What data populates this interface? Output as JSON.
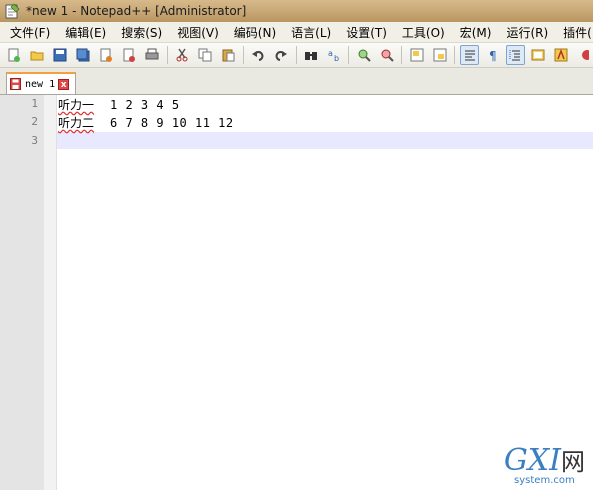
{
  "window": {
    "title": "*new 1 - Notepad++ [Administrator]"
  },
  "menubar": {
    "items": [
      "文件(F)",
      "编辑(E)",
      "搜索(S)",
      "视图(V)",
      "编码(N)",
      "语言(L)",
      "设置(T)",
      "工具(O)",
      "宏(M)",
      "运行(R)",
      "插件(P)"
    ]
  },
  "toolbar": {
    "icons": [
      "new-file-icon",
      "open-file-icon",
      "save-icon",
      "save-all-icon",
      "close-icon",
      "close-all-icon",
      "print-icon",
      "cut-icon",
      "copy-icon",
      "paste-icon",
      "undo-icon",
      "redo-icon",
      "find-icon",
      "replace-icon",
      "zoom-in-icon",
      "zoom-out-icon",
      "sync-vertical-icon",
      "sync-horizontal-icon",
      "word-wrap-icon",
      "show-all-chars-icon",
      "indent-guide-icon",
      "doc-map-icon",
      "function-list-icon",
      "record-macro-icon"
    ]
  },
  "tabs": [
    {
      "label": "new 1",
      "close": "x"
    }
  ],
  "editor": {
    "lines": [
      {
        "number": "1",
        "label": "听力一",
        "values": "1 2 3 4 5"
      },
      {
        "number": "2",
        "label": "听力二",
        "values": "6 7 8 9 10 11 12"
      },
      {
        "number": "3",
        "label": "",
        "values": ""
      }
    ],
    "current_line": 3
  },
  "watermark": {
    "logo_text": "GXI",
    "logo_suffix": "网",
    "site": "system.com"
  }
}
